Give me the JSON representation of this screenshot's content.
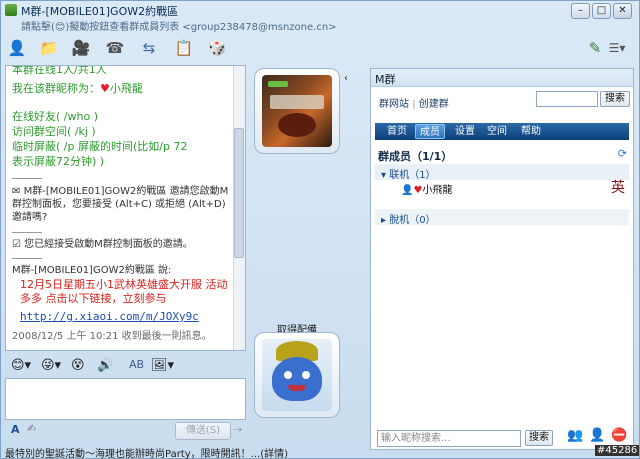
{
  "window": {
    "title": "M群-[MOBILE01]GOW2約戰區",
    "subtitle": "請點擊(😊)擬動按鈕查看群成員列表 <group238478@msnzone.cn>"
  },
  "chat": {
    "lines_green": [
      "本群在线1人/共1人",
      "我在该群昵称为：",
      "小飛龍",
      "在线好友( /who )",
      "访问群空间( /kj )",
      "临时屏蔽( /p 屏蔽的时间(比如/p 72",
      "表示屏蔽72分钟) )"
    ],
    "sys_msg1": "M群-[MOBILE01]GOW2約戰區 邀請您啟動M群控制面板，您要接受 (Alt+C) 或拒絕 (Alt+D) 邀請嗎?",
    "sys_msg2": "您已經接受啟動M群控制面板的邀請。",
    "sender": "M群-[MOBILE01]GOW2約戰區 說:",
    "red_msg": "12月5日星期五小1武林英雄盛大开服  活动多多    点击以下链接，立刻参与",
    "link": "http://g.xiaoi.com/m/JOXy9c",
    "timestamp": "2008/12/5 上午 10:21 收到最後一則訊息。"
  },
  "input": {
    "send_label": "傳送(S)"
  },
  "avatars": {
    "bottom_label": "取得配備"
  },
  "right_panel": {
    "header": "M群",
    "links": [
      "群网站",
      "创建群"
    ],
    "search_button": "搜索",
    "tabs": [
      "首页",
      "成员",
      "设置",
      "空间",
      "帮助"
    ],
    "members_title": "群成员（1/1）",
    "online_group": "▾ 联机（1）",
    "offline_group": "▸ 脫机（0）",
    "member_name": "小飛龍",
    "bottom_search_placeholder": "输入昵称搜索...",
    "bottom_search_button": "搜索"
  },
  "status_text": "最特別的聖誕活動～海理也能辦時尚Party，限時開訊！...(詳情)",
  "watermark": "#45286"
}
